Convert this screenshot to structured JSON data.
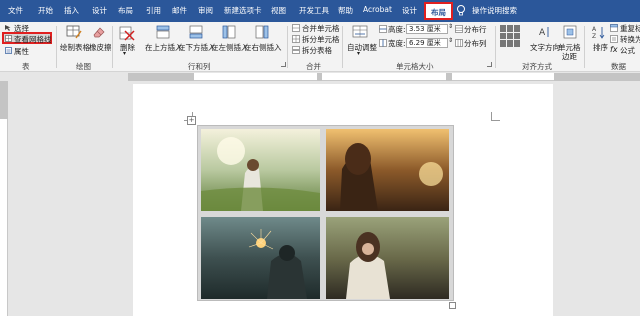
{
  "tabs": [
    "文件",
    "开始",
    "插入",
    "设计",
    "布局",
    "引用",
    "邮件",
    "审阅",
    "新建选项卡",
    "视图",
    "开发工具",
    "帮助",
    "Acrobat",
    "设计",
    "布局"
  ],
  "tell_me": "操作说明搜索",
  "ribbon": {
    "select": "选择",
    "view_gridlines": "查看网格线",
    "properties": "属性",
    "group_table": "表",
    "draw_table": "绘制表格",
    "eraser": "橡皮擦",
    "group_draw": "绘图",
    "delete": "删除",
    "insert_above": "在上方插入",
    "insert_below": "在下方插入",
    "insert_left": "在左侧插入",
    "insert_right": "在右侧插入",
    "group_rows_cols": "行和列",
    "merge_cells": "合并单元格",
    "split_cells": "拆分单元格",
    "split_table": "拆分表格",
    "group_merge": "合并",
    "autofit": "自动调整",
    "height_label": "高度:",
    "height_value": "3.53 厘米",
    "width_label": "宽度:",
    "width_value": "6.29 厘米",
    "distribute_rows": "分布行",
    "distribute_cols": "分布列",
    "group_cell_size": "单元格大小",
    "text_direction": "文字方向",
    "cell_margins_1": "单元格",
    "cell_margins_2": "边距",
    "group_alignment": "对齐方式",
    "sort": "排序",
    "repeat_header": "重复标",
    "convert_to": "转换为",
    "formula": "公式",
    "group_data": "数据"
  },
  "photos": [
    {
      "name": "woman-in-sunny-meadow",
      "colors": [
        "#f4f1dc",
        "#b9c9a0",
        "#5f7d3a"
      ]
    },
    {
      "name": "woman-at-sunset-field",
      "colors": [
        "#f0c070",
        "#8c5a2a",
        "#3a2414"
      ]
    },
    {
      "name": "woman-with-sparkler",
      "colors": [
        "#6f8a8a",
        "#3e5050",
        "#1e2a2a"
      ]
    },
    {
      "name": "woman-in-autumn-field",
      "colors": [
        "#9aa27a",
        "#6a6a4a",
        "#2e2a22"
      ]
    }
  ],
  "colors": {
    "accent": "#2b579a",
    "highlight": "#e02020"
  }
}
